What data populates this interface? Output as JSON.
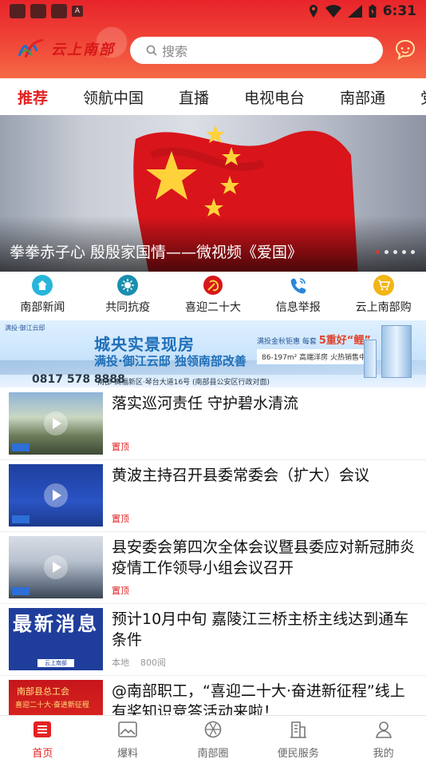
{
  "status_bar": {
    "time": "6:31"
  },
  "header": {
    "logo_text": "云上南部",
    "search_placeholder": "搜索"
  },
  "tabs": [
    {
      "label": "推荐",
      "active": true
    },
    {
      "label": "领航中国"
    },
    {
      "label": "直播"
    },
    {
      "label": "电视电台"
    },
    {
      "label": "南部通"
    },
    {
      "label": "党"
    }
  ],
  "banner": {
    "caption": "拳拳赤子心 殷殷家国情——微视频《爱国》",
    "page_count": 5,
    "active_index": 0
  },
  "quick_nav": [
    {
      "label": "南部新闻",
      "icon": "home-icon",
      "color": "#27b5d9"
    },
    {
      "label": "共同抗疫",
      "icon": "virus-icon",
      "color": "#1a8fb0"
    },
    {
      "label": "喜迎二十大",
      "icon": "party-emblem-icon",
      "color": "#d8161b"
    },
    {
      "label": "信息举报",
      "icon": "phone-icon",
      "color": "#2a86d9"
    },
    {
      "label": "云上南部购",
      "icon": "cart-icon",
      "color": "#f2b515"
    }
  ],
  "ad": {
    "brand": "满投·御江云邸",
    "title": "城央实景现房",
    "subtitle": "满投·御江云邸  独领南部改善",
    "badge_prefix": "满投金秋钜惠 每套",
    "badge_highlight": "5重好“鲤”",
    "size_text": "86-197m² 高端洋房 火热销售中",
    "phone": "0817 578 8888",
    "address": "南部·满福新区·琴台大道16号 (南部县公安区行政对面)"
  },
  "news": [
    {
      "title": "落实巡河责任 守护碧水清流",
      "pinned": "置顶",
      "thumb": "t1",
      "has_video": true
    },
    {
      "title": "黄波主持召开县委常委会（扩大）会议",
      "pinned": "置顶",
      "thumb": "t2",
      "has_video": true
    },
    {
      "title": "县安委会第四次全体会议暨县委应对新冠肺炎疫情工作领导小组会议召开",
      "pinned": "置顶",
      "thumb": "t3",
      "has_video": true
    },
    {
      "title": "预计10月中旬 嘉陵江三桥主桥主线达到通车条件",
      "source": "本地",
      "views": "800阅",
      "thumb": "t4",
      "thumb_text": "最新消息",
      "thumb_small": "云上南部"
    },
    {
      "title": "@南部职工，“喜迎二十大·奋进新征程”线上有奖知识竞答活动来啦！",
      "thumb": "t5",
      "thumb_line1": "南部县总工会",
      "thumb_line2": "喜迎二十大·奋进新征程"
    }
  ],
  "bottom_nav": [
    {
      "label": "首页",
      "icon": "home-list-icon",
      "active": true
    },
    {
      "label": "爆料",
      "icon": "image-icon"
    },
    {
      "label": "南部圈",
      "icon": "aperture-icon"
    },
    {
      "label": "便民服务",
      "icon": "building-icon"
    },
    {
      "label": "我的",
      "icon": "user-icon"
    }
  ]
}
